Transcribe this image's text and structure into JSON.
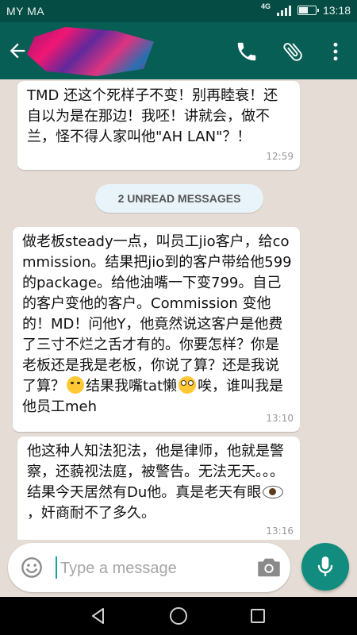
{
  "status_bar": {
    "carrier": "MY MA",
    "network": "4G",
    "time": "13:18",
    "battery_level": 0.6
  },
  "app_bar": {
    "icons": [
      "back-arrow-icon",
      "phone-icon",
      "paperclip-icon",
      "more-vert-icon"
    ]
  },
  "messages": [
    {
      "text": "TMD 还这个死样子不变！别再睦衰！还自以为是在那边！我呸！讲就会，做不兰，怪不得人家叫他\"AH LAN\"？！",
      "time": "12:59"
    },
    {
      "text_parts": [
        "做老板steady一点，叫员工jio客户，给commission。结果把jio到的客户带给他599的package。给他油嘴一下变799。自己的客户变他的客户。Commission 变他的！MD！问他Y，他竟然说这客户是他费了三寸不烂之舌才有的。你要怎样？你是老板还是我是老板，你说了算？还是我说了算？",
        "结果我嘴tat懒",
        "唉，谁叫我是他员工meh"
      ],
      "emojis": [
        "face-with-steam-icon",
        "flushed-face-icon"
      ],
      "time": "13:10"
    },
    {
      "text_parts": [
        "他这种人知法犯法，他是律师，他就是警察，还藐视法庭，被警告。无法无天。。。结果今天居然有Du他。真是老天有眼",
        "，奸商耐不了多久。"
      ],
      "emojis": [
        "eye-icon"
      ],
      "time": "13:16"
    }
  ],
  "unread_divider": "2 UNREAD MESSAGES",
  "composer": {
    "placeholder": "Type a message",
    "icons": [
      "emoji-icon",
      "camera-icon",
      "mic-icon"
    ],
    "accent": "#128c7e"
  },
  "nav_bar": {
    "icons": [
      "nav-back-icon",
      "nav-home-icon",
      "nav-recents-icon"
    ]
  },
  "colors": {
    "header": "#075e54",
    "status_bar": "#054d44",
    "chat_background": "#e5ddd5",
    "bubble": "#ffffff"
  }
}
